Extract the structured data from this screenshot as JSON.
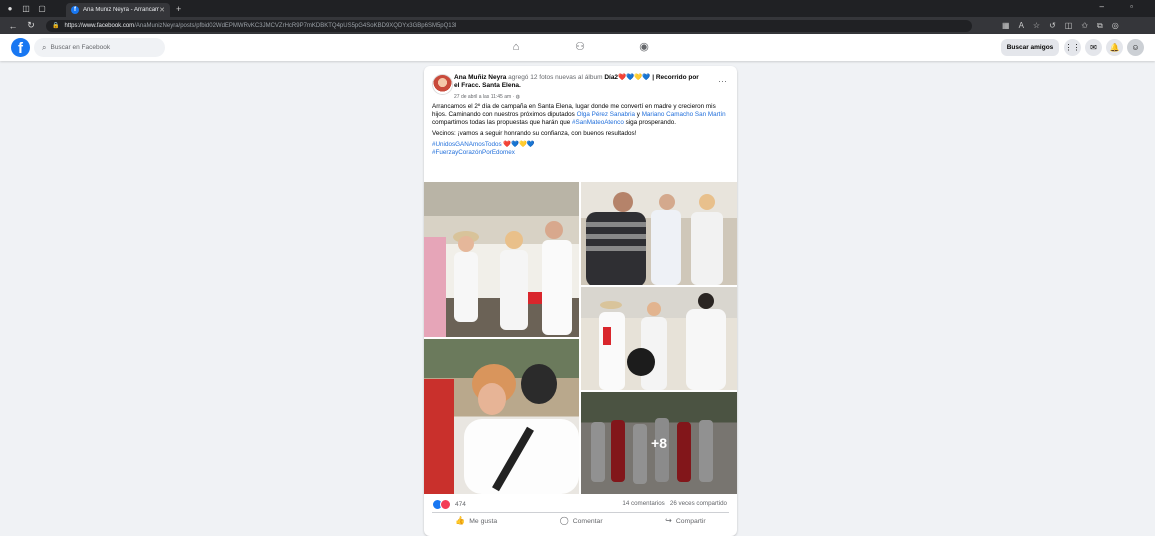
{
  "browser": {
    "tab_title": "Ana Muñiz Neyra - Arrancamos",
    "url_host": "https://www.facebook.com",
    "url_path": "/AnaMunizNeyra/posts/pfbid02WdEPMWRvKC3JMCVZrHcR9P7mKDBKTQ4pUS5pG4SoKBD9XQDYx3GBp6SM5pQ13l"
  },
  "header": {
    "search_placeholder": "Buscar en Facebook",
    "find_friends": "Buscar amigos"
  },
  "post": {
    "author": "Ana Muñiz Neyra",
    "action_text": " agregó 12 fotos nuevas al álbum ",
    "album": "Día2❤️💙💛💙 | Recorrido por el Fracc. Santa Elena.",
    "timestamp": "27 de abril a las 11:45 am · ",
    "text_1a": "Arrancamos el 2º día de campaña en Santa Elena, lugar donde me convertí en madre y crecieron mis hijos. Caminando con nuestros próximos diputados ",
    "mention_1": "Olga Pérez Sanabria",
    "text_1b": " y ",
    "mention_2": "Mariano Camacho San Martín",
    "text_1c": " compartimos todas las propuestas que harán que ",
    "hashtag_1": "#SanMateoAtenco",
    "text_1d": " siga prosperando.",
    "text_2": "Vecinos: ¡vamos a seguir honrando su confianza, con buenos resultados!",
    "hashtag_2": "#UnidosGANAmosTodos ❤️💙💛💙",
    "hashtag_3": "#FuerzayCorazónPorEdomex",
    "more_photos": "+8",
    "reaction_count": "474",
    "comments": "14 comentarios",
    "shares": "26 veces compartido",
    "like": "Me gusta",
    "comment": "Comentar",
    "share": "Compartir"
  }
}
